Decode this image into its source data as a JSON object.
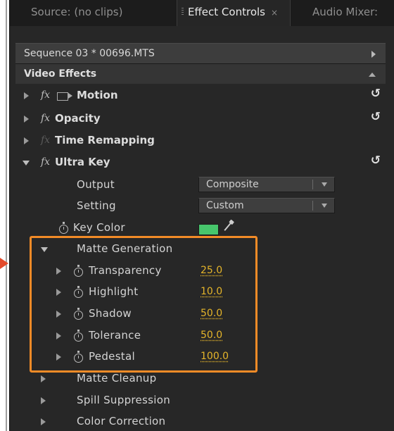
{
  "tabs": [
    {
      "label": "Source: (no clips)"
    },
    {
      "label": "Effect Controls",
      "close": "×"
    },
    {
      "label": "Audio Mixer:"
    }
  ],
  "sequence": {
    "label": "Sequence 03 * 00696.MTS"
  },
  "video_effects": {
    "label": "Video Effects"
  },
  "effects": [
    {
      "fx": "fx",
      "label": "Motion"
    },
    {
      "fx": "fx",
      "label": "Opacity"
    },
    {
      "fx": "fx",
      "label": "Time Remapping"
    },
    {
      "fx": "fx",
      "label": "Ultra Key"
    }
  ],
  "ultra_key": {
    "output": {
      "label": "Output",
      "value": "Composite"
    },
    "setting": {
      "label": "Setting",
      "value": "Custom"
    },
    "key_color": {
      "label": "Key Color",
      "color": "#47c66c"
    }
  },
  "matte_generation": {
    "label": "Matte Generation",
    "params": [
      {
        "label": "Transparency",
        "value": "25.0"
      },
      {
        "label": "Highlight",
        "value": "10.0"
      },
      {
        "label": "Shadow",
        "value": "50.0"
      },
      {
        "label": "Tolerance",
        "value": "50.0"
      },
      {
        "label": "Pedestal",
        "value": "100.0"
      }
    ]
  },
  "groups": [
    {
      "label": "Matte Cleanup"
    },
    {
      "label": "Spill Suppression"
    },
    {
      "label": "Color Correction"
    }
  ],
  "colors": {
    "accent_value": "#e5b52a",
    "highlight_box": "#f28b27",
    "pointer": "#e34b2c"
  }
}
